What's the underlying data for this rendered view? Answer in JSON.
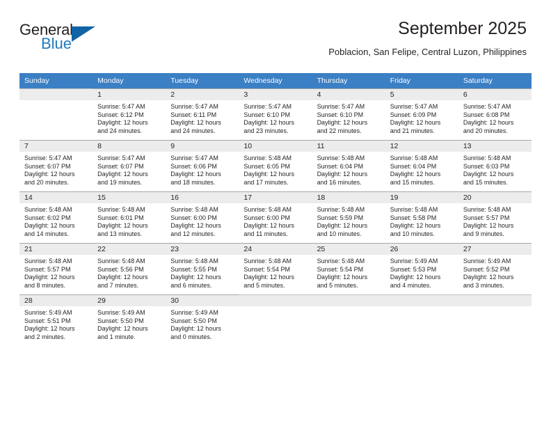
{
  "brand": {
    "name_top": "General",
    "name_bottom": "Blue",
    "triangle_icon": "triangle-icon",
    "accent_color": "#1263a5",
    "text_color": "#231f20"
  },
  "header": {
    "title": "September 2025",
    "subtitle": "Poblacion, San Felipe, Central Luzon, Philippines"
  },
  "calendar": {
    "header_bg": "#3b7fc4",
    "header_text_color": "#ffffff",
    "daynum_bg": "#ececec",
    "weekdays": [
      "Sunday",
      "Monday",
      "Tuesday",
      "Wednesday",
      "Thursday",
      "Friday",
      "Saturday"
    ],
    "weeks": [
      [
        {
          "day": "",
          "sunrise": "",
          "sunset": "",
          "daylight_line1": "",
          "daylight_line2": ""
        },
        {
          "day": "1",
          "sunrise": "Sunrise: 5:47 AM",
          "sunset": "Sunset: 6:12 PM",
          "daylight_line1": "Daylight: 12 hours",
          "daylight_line2": "and 24 minutes."
        },
        {
          "day": "2",
          "sunrise": "Sunrise: 5:47 AM",
          "sunset": "Sunset: 6:11 PM",
          "daylight_line1": "Daylight: 12 hours",
          "daylight_line2": "and 24 minutes."
        },
        {
          "day": "3",
          "sunrise": "Sunrise: 5:47 AM",
          "sunset": "Sunset: 6:10 PM",
          "daylight_line1": "Daylight: 12 hours",
          "daylight_line2": "and 23 minutes."
        },
        {
          "day": "4",
          "sunrise": "Sunrise: 5:47 AM",
          "sunset": "Sunset: 6:10 PM",
          "daylight_line1": "Daylight: 12 hours",
          "daylight_line2": "and 22 minutes."
        },
        {
          "day": "5",
          "sunrise": "Sunrise: 5:47 AM",
          "sunset": "Sunset: 6:09 PM",
          "daylight_line1": "Daylight: 12 hours",
          "daylight_line2": "and 21 minutes."
        },
        {
          "day": "6",
          "sunrise": "Sunrise: 5:47 AM",
          "sunset": "Sunset: 6:08 PM",
          "daylight_line1": "Daylight: 12 hours",
          "daylight_line2": "and 20 minutes."
        }
      ],
      [
        {
          "day": "7",
          "sunrise": "Sunrise: 5:47 AM",
          "sunset": "Sunset: 6:07 PM",
          "daylight_line1": "Daylight: 12 hours",
          "daylight_line2": "and 20 minutes."
        },
        {
          "day": "8",
          "sunrise": "Sunrise: 5:47 AM",
          "sunset": "Sunset: 6:07 PM",
          "daylight_line1": "Daylight: 12 hours",
          "daylight_line2": "and 19 minutes."
        },
        {
          "day": "9",
          "sunrise": "Sunrise: 5:47 AM",
          "sunset": "Sunset: 6:06 PM",
          "daylight_line1": "Daylight: 12 hours",
          "daylight_line2": "and 18 minutes."
        },
        {
          "day": "10",
          "sunrise": "Sunrise: 5:48 AM",
          "sunset": "Sunset: 6:05 PM",
          "daylight_line1": "Daylight: 12 hours",
          "daylight_line2": "and 17 minutes."
        },
        {
          "day": "11",
          "sunrise": "Sunrise: 5:48 AM",
          "sunset": "Sunset: 6:04 PM",
          "daylight_line1": "Daylight: 12 hours",
          "daylight_line2": "and 16 minutes."
        },
        {
          "day": "12",
          "sunrise": "Sunrise: 5:48 AM",
          "sunset": "Sunset: 6:04 PM",
          "daylight_line1": "Daylight: 12 hours",
          "daylight_line2": "and 15 minutes."
        },
        {
          "day": "13",
          "sunrise": "Sunrise: 5:48 AM",
          "sunset": "Sunset: 6:03 PM",
          "daylight_line1": "Daylight: 12 hours",
          "daylight_line2": "and 15 minutes."
        }
      ],
      [
        {
          "day": "14",
          "sunrise": "Sunrise: 5:48 AM",
          "sunset": "Sunset: 6:02 PM",
          "daylight_line1": "Daylight: 12 hours",
          "daylight_line2": "and 14 minutes."
        },
        {
          "day": "15",
          "sunrise": "Sunrise: 5:48 AM",
          "sunset": "Sunset: 6:01 PM",
          "daylight_line1": "Daylight: 12 hours",
          "daylight_line2": "and 13 minutes."
        },
        {
          "day": "16",
          "sunrise": "Sunrise: 5:48 AM",
          "sunset": "Sunset: 6:00 PM",
          "daylight_line1": "Daylight: 12 hours",
          "daylight_line2": "and 12 minutes."
        },
        {
          "day": "17",
          "sunrise": "Sunrise: 5:48 AM",
          "sunset": "Sunset: 6:00 PM",
          "daylight_line1": "Daylight: 12 hours",
          "daylight_line2": "and 11 minutes."
        },
        {
          "day": "18",
          "sunrise": "Sunrise: 5:48 AM",
          "sunset": "Sunset: 5:59 PM",
          "daylight_line1": "Daylight: 12 hours",
          "daylight_line2": "and 10 minutes."
        },
        {
          "day": "19",
          "sunrise": "Sunrise: 5:48 AM",
          "sunset": "Sunset: 5:58 PM",
          "daylight_line1": "Daylight: 12 hours",
          "daylight_line2": "and 10 minutes."
        },
        {
          "day": "20",
          "sunrise": "Sunrise: 5:48 AM",
          "sunset": "Sunset: 5:57 PM",
          "daylight_line1": "Daylight: 12 hours",
          "daylight_line2": "and 9 minutes."
        }
      ],
      [
        {
          "day": "21",
          "sunrise": "Sunrise: 5:48 AM",
          "sunset": "Sunset: 5:57 PM",
          "daylight_line1": "Daylight: 12 hours",
          "daylight_line2": "and 8 minutes."
        },
        {
          "day": "22",
          "sunrise": "Sunrise: 5:48 AM",
          "sunset": "Sunset: 5:56 PM",
          "daylight_line1": "Daylight: 12 hours",
          "daylight_line2": "and 7 minutes."
        },
        {
          "day": "23",
          "sunrise": "Sunrise: 5:48 AM",
          "sunset": "Sunset: 5:55 PM",
          "daylight_line1": "Daylight: 12 hours",
          "daylight_line2": "and 6 minutes."
        },
        {
          "day": "24",
          "sunrise": "Sunrise: 5:48 AM",
          "sunset": "Sunset: 5:54 PM",
          "daylight_line1": "Daylight: 12 hours",
          "daylight_line2": "and 5 minutes."
        },
        {
          "day": "25",
          "sunrise": "Sunrise: 5:48 AM",
          "sunset": "Sunset: 5:54 PM",
          "daylight_line1": "Daylight: 12 hours",
          "daylight_line2": "and 5 minutes."
        },
        {
          "day": "26",
          "sunrise": "Sunrise: 5:49 AM",
          "sunset": "Sunset: 5:53 PM",
          "daylight_line1": "Daylight: 12 hours",
          "daylight_line2": "and 4 minutes."
        },
        {
          "day": "27",
          "sunrise": "Sunrise: 5:49 AM",
          "sunset": "Sunset: 5:52 PM",
          "daylight_line1": "Daylight: 12 hours",
          "daylight_line2": "and 3 minutes."
        }
      ],
      [
        {
          "day": "28",
          "sunrise": "Sunrise: 5:49 AM",
          "sunset": "Sunset: 5:51 PM",
          "daylight_line1": "Daylight: 12 hours",
          "daylight_line2": "and 2 minutes."
        },
        {
          "day": "29",
          "sunrise": "Sunrise: 5:49 AM",
          "sunset": "Sunset: 5:50 PM",
          "daylight_line1": "Daylight: 12 hours",
          "daylight_line2": "and 1 minute."
        },
        {
          "day": "30",
          "sunrise": "Sunrise: 5:49 AM",
          "sunset": "Sunset: 5:50 PM",
          "daylight_line1": "Daylight: 12 hours",
          "daylight_line2": "and 0 minutes."
        },
        {
          "day": "",
          "sunrise": "",
          "sunset": "",
          "daylight_line1": "",
          "daylight_line2": ""
        },
        {
          "day": "",
          "sunrise": "",
          "sunset": "",
          "daylight_line1": "",
          "daylight_line2": ""
        },
        {
          "day": "",
          "sunrise": "",
          "sunset": "",
          "daylight_line1": "",
          "daylight_line2": ""
        },
        {
          "day": "",
          "sunrise": "",
          "sunset": "",
          "daylight_line1": "",
          "daylight_line2": ""
        }
      ]
    ]
  }
}
